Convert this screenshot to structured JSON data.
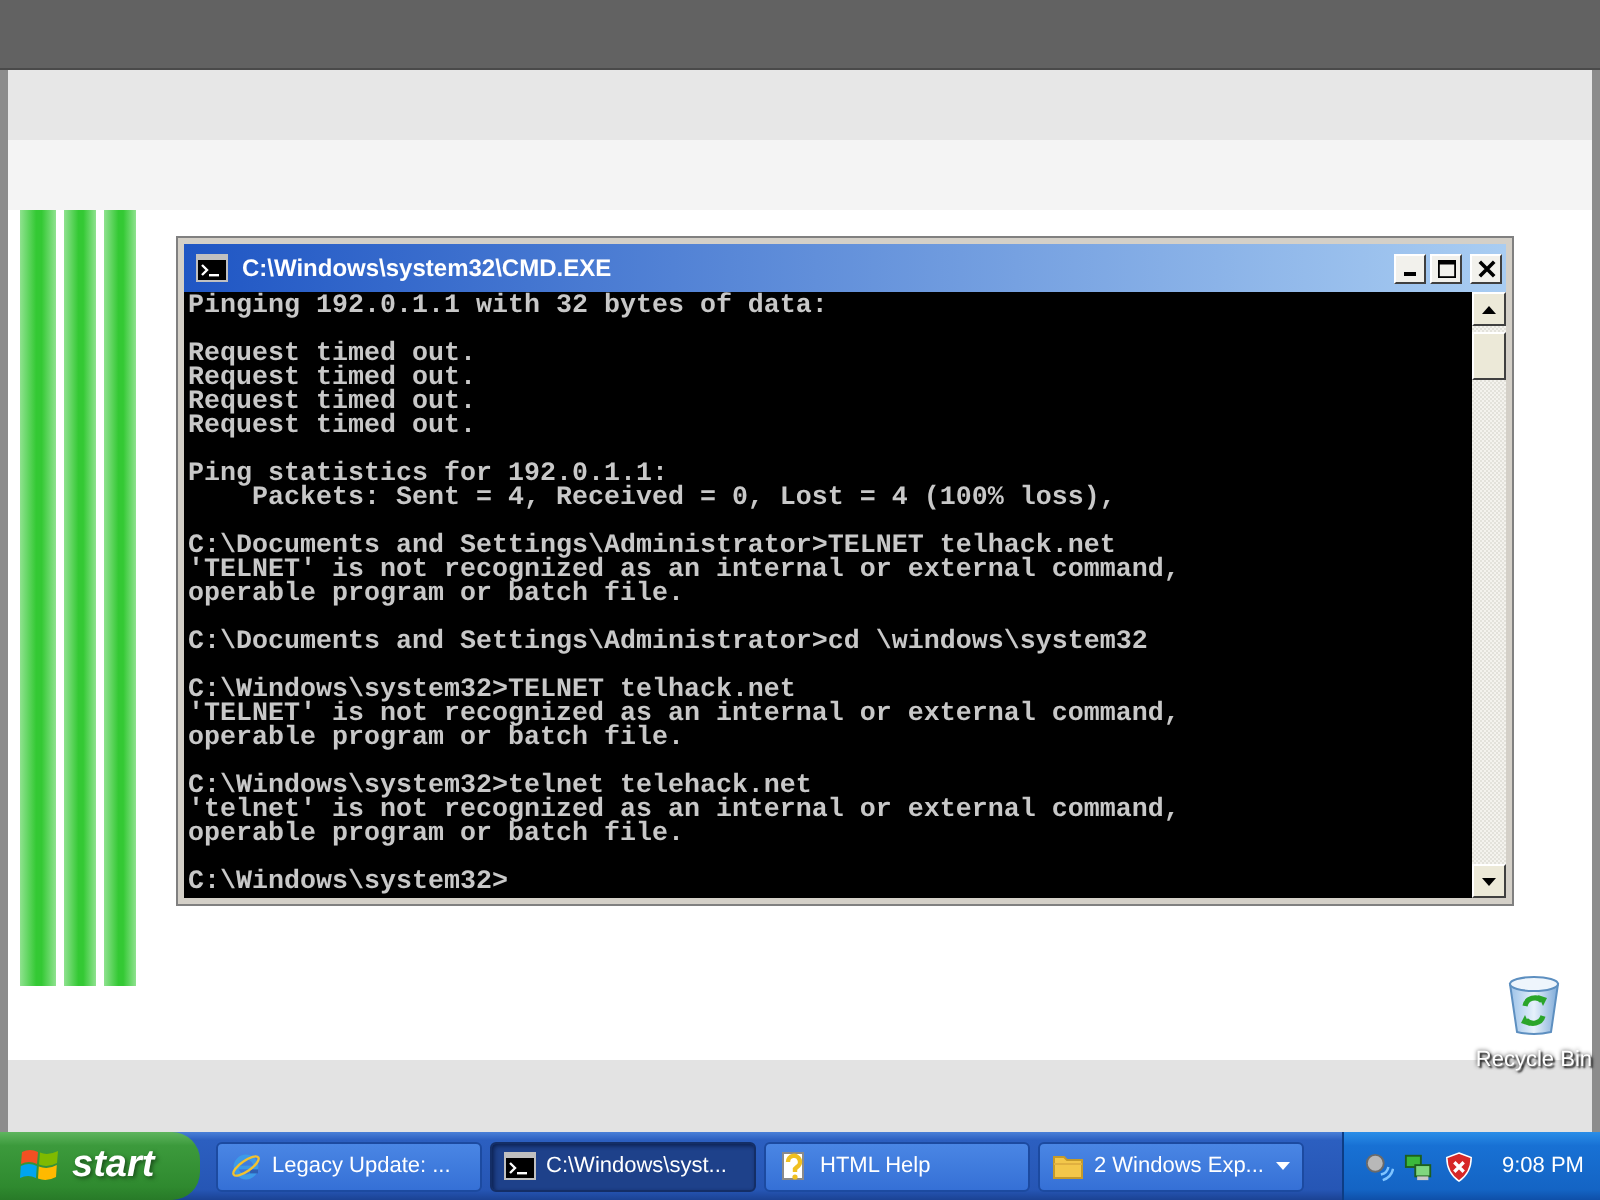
{
  "console_window": {
    "title": "C:\\Windows\\system32\\CMD.EXE",
    "output_blocks": [
      [
        "Pinging 192.0.1.1 with 32 bytes of data:"
      ],
      [
        "Request timed out.",
        "Request timed out.",
        "Request timed out.",
        "Request timed out."
      ],
      [
        "Ping statistics for 192.0.1.1:",
        "    Packets: Sent = 4, Received = 0, Lost = 4 (100% loss),"
      ],
      [
        "C:\\Documents and Settings\\Administrator>TELNET telhack.net",
        "'TELNET' is not recognized as an internal or external command,",
        "operable program or batch file."
      ],
      [
        "C:\\Documents and Settings\\Administrator>cd \\windows\\system32"
      ],
      [
        "C:\\Windows\\system32>TELNET telhack.net",
        "'TELNET' is not recognized as an internal or external command,",
        "operable program or batch file."
      ],
      [
        "C:\\Windows\\system32>telnet telehack.net",
        "'telnet' is not recognized as an internal or external command,",
        "operable program or batch file."
      ],
      [
        "C:\\Windows\\system32>"
      ]
    ]
  },
  "desktop_icons": [
    {
      "label": "Recycle Bin"
    }
  ],
  "taskbar": {
    "start_label": "start",
    "tasks": [
      {
        "kind": "browser",
        "label": "Legacy Update: ...",
        "selected": false
      },
      {
        "kind": "console",
        "label": "C:\\Windows\\syst...",
        "selected": true
      },
      {
        "kind": "help",
        "label": "HTML Help",
        "selected": false
      },
      {
        "kind": "group",
        "label": "2 Windows Exp...",
        "selected": false
      }
    ],
    "clock": "9:08 PM"
  }
}
